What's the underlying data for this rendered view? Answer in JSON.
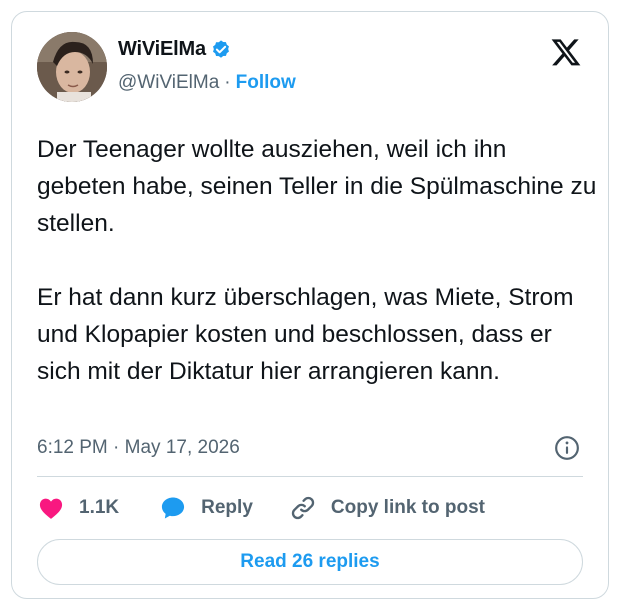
{
  "author": {
    "display_name": "WiViElMa",
    "handle": "@WiViElMa",
    "separator": "·",
    "follow_label": "Follow"
  },
  "tweet": {
    "text": "Der Teenager wollte ausziehen, weil ich ihn gebeten habe, seinen Teller in die Spülmaschine zu stellen.\n\nEr hat dann kurz überschlagen, was Miete, Strom und Klopapier kosten und beschlossen, dass er sich mit der Diktatur hier arrangieren kann.",
    "timestamp": "6:12 PM · May 17, 2026"
  },
  "actions": {
    "like_count": "1.1K",
    "reply_label": "Reply",
    "copy_link_label": "Copy link to post"
  },
  "footer": {
    "read_replies_label": "Read 26 replies"
  },
  "colors": {
    "accent": "#1d9bf0",
    "like": "#f91880",
    "muted": "#536471",
    "text": "#0f1419",
    "border": "#cfd9de"
  },
  "icons": [
    "verified-badge-icon",
    "x-logo-icon",
    "info-icon",
    "heart-icon",
    "reply-bubble-icon",
    "link-icon"
  ]
}
